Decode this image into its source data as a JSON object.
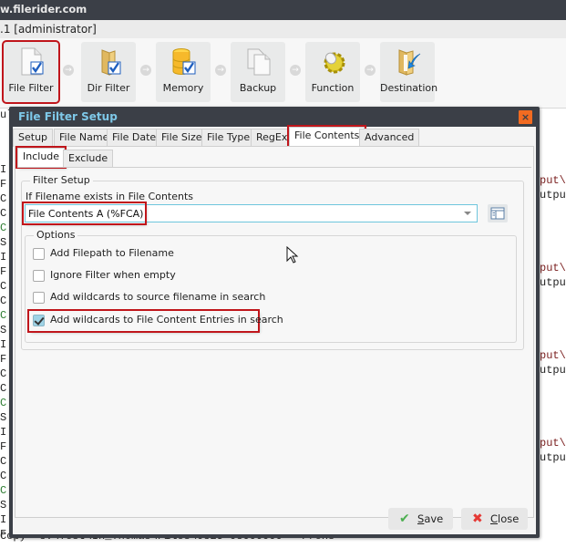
{
  "app": {
    "title": "w.filerider.com",
    "subtitle": ".1 [administrator]"
  },
  "workflow": {
    "steps": [
      {
        "label": "File Filter",
        "icon": "file-check-icon",
        "active": true
      },
      {
        "label": "Dir Filter",
        "icon": "folder-check-icon",
        "active": false
      },
      {
        "label": "Memory",
        "icon": "database-check-icon",
        "active": false
      },
      {
        "label": "Backup",
        "icon": "copy-files-icon",
        "active": false
      },
      {
        "label": "Function",
        "icon": "gear-icon",
        "active": false
      },
      {
        "label": "Destination",
        "icon": "folder-arrow-icon",
        "active": false
      }
    ],
    "arrow_glyph": "→"
  },
  "log": {
    "left_fragment": "ul",
    "left_letters": [
      "I",
      "F",
      "C",
      "C",
      "C",
      "S",
      "I",
      "F",
      "C",
      "C",
      "C",
      "S",
      "I",
      "F",
      "C",
      "C",
      "C",
      "S",
      "I",
      "F",
      "C",
      "C",
      "C",
      "S",
      "I",
      "F"
    ],
    "green_indices": [
      4,
      10,
      16,
      22
    ],
    "right_fragments": [
      "put\\",
      "utpu"
    ],
    "bottom_line": "Copy  8:\\Test\\In_Thomas\\Files\\0825-08000000 - Prons"
  },
  "dialog": {
    "title": "File Filter Setup",
    "close_glyph": "×",
    "tabs": [
      {
        "label": "Setup",
        "active": false
      },
      {
        "label": "File Name",
        "active": false
      },
      {
        "label": "File Date",
        "active": false
      },
      {
        "label": "File Size",
        "active": false
      },
      {
        "label": "File Type",
        "active": false
      },
      {
        "label": "RegEx",
        "active": false
      },
      {
        "label": "File Contents",
        "active": true
      },
      {
        "label": "Advanced",
        "active": false
      }
    ],
    "subtabs": [
      {
        "label": "Include",
        "active": true
      },
      {
        "label": "Exclude",
        "active": false
      }
    ],
    "filter_setup": {
      "legend": "Filter Setup",
      "field_label": "If Filename exists in File Contents",
      "combo_value": "File Contents A (%FCA)",
      "browse_icon": "list-view-icon"
    },
    "options": {
      "legend": "Options",
      "items": [
        {
          "label": "Add Filepath to Filename",
          "checked": false
        },
        {
          "label": "Ignore Filter when empty",
          "checked": false
        },
        {
          "label": "Add wildcards to source filename in search",
          "checked": false
        },
        {
          "label": "Add wildcards to File Content Entries in search",
          "checked": true
        }
      ]
    },
    "footer": {
      "save_label": "Save",
      "close_label": "Close",
      "save_icon": "✔",
      "close_icon": "✖",
      "save_icon_color": "#4caf50",
      "close_icon_color": "#e53935"
    }
  },
  "colors": {
    "accent_title": "#7ec8e8",
    "highlight_red": "#c0151b",
    "close_orange": "#f26b21",
    "chrome_dark": "#3b3f47"
  }
}
